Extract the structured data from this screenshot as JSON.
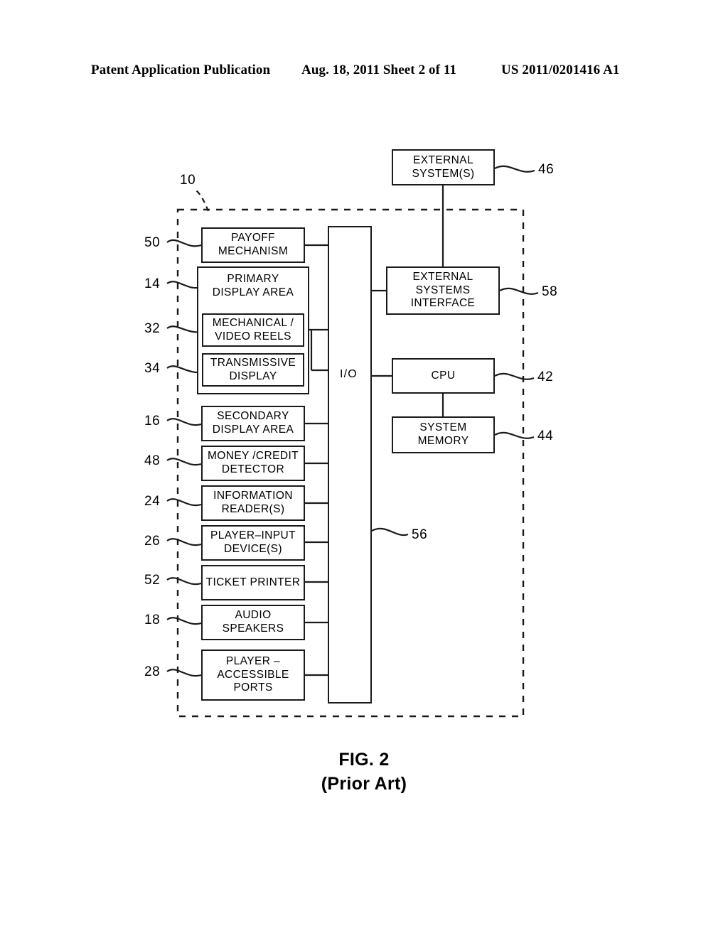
{
  "header": {
    "left": "Patent Application Publication",
    "middle": "Aug. 18, 2011  Sheet 2 of 11",
    "right": "US 2011/0201416 A1"
  },
  "caption": {
    "figure": "FIG. 2",
    "note": "(Prior Art)"
  },
  "diagram": {
    "boundary_ref": "10",
    "io_label": "I/O",
    "io_ref": "56",
    "nodes": {
      "external_systems": {
        "line1": "EXTERNAL",
        "line2": "SYSTEM(S)",
        "ref": "46"
      },
      "payoff_mechanism": {
        "line1": "PAYOFF",
        "line2": "MECHANISM",
        "ref": "50"
      },
      "primary_display_area": {
        "line1": "PRIMARY",
        "line2": "DISPLAY  AREA",
        "ref": "14"
      },
      "mechanical_video_reels": {
        "line1": "MECHANICAL /",
        "line2": "VIDEO  REELS",
        "ref": "32"
      },
      "transmissive_display": {
        "line1": "TRANSMISSIVE",
        "line2": "DISPLAY",
        "ref": "34"
      },
      "secondary_display_area": {
        "line1": "SECONDARY",
        "line2": "DISPLAY  AREA",
        "ref": "16"
      },
      "money_credit_detector": {
        "line1": "MONEY /CREDIT",
        "line2": "DETECTOR",
        "ref": "48"
      },
      "information_readers": {
        "line1": "INFORMATION",
        "line2": "READER(S)",
        "ref": "24"
      },
      "player_input_devices": {
        "line1": "PLAYER–INPUT",
        "line2": "DEVICE(S)",
        "ref": "26"
      },
      "ticket_printer": {
        "line1": "TICKET  PRINTER",
        "line2": "",
        "ref": "52"
      },
      "audio_speakers": {
        "line1": "AUDIO",
        "line2": "SPEAKERS",
        "ref": "18"
      },
      "player_accessible_ports": {
        "line1": "PLAYER  –",
        "line2": "ACCESSIBLE",
        "line3": "PORTS",
        "ref": "28"
      },
      "external_systems_interface": {
        "line1": "EXTERNAL",
        "line2": "SYSTEMS",
        "line3": "INTERFACE",
        "ref": "58"
      },
      "cpu": {
        "line1": "CPU",
        "line2": "",
        "ref": "42"
      },
      "system_memory": {
        "line1": "SYSTEM",
        "line2": "MEMORY",
        "ref": "44"
      }
    }
  },
  "colors": {
    "ink": "#1a1a1a",
    "paper": "#ffffff"
  }
}
